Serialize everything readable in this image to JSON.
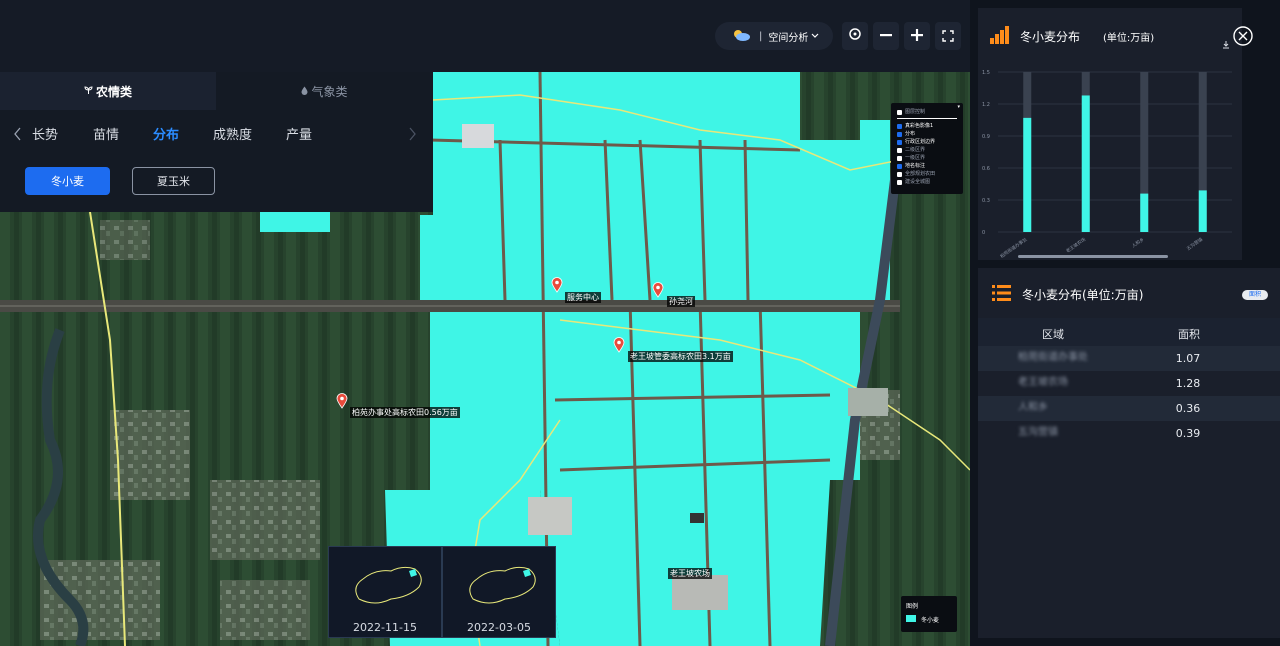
{
  "toolbar": {
    "weather_icon": "cloud-sun-icon",
    "spatial_analysis_label": "空间分析",
    "spatial_analysis_icon": "chevron-down-icon",
    "locate_icon": "locate-icon",
    "zoom_out_icon": "minus-icon",
    "zoom_in_icon": "plus-icon",
    "fullscreen_icon": "fullscreen-icon"
  },
  "left_panel": {
    "tabs": [
      {
        "label": "农情类",
        "icon": "sprout-icon",
        "active": true
      },
      {
        "label": "气象类",
        "icon": "droplet-icon",
        "active": false
      }
    ],
    "subnav": [
      {
        "label": "长势",
        "active": false
      },
      {
        "label": "苗情",
        "active": false
      },
      {
        "label": "分布",
        "active": true
      },
      {
        "label": "成熟度",
        "active": false
      },
      {
        "label": "产量",
        "active": false
      }
    ],
    "prev_icon": "chevron-left-icon",
    "next_icon": "chevron-right-icon",
    "crops": [
      {
        "label": "冬小麦",
        "active": true
      },
      {
        "label": "夏玉米",
        "active": false
      }
    ]
  },
  "map_labels": [
    {
      "text": "服务中心"
    },
    {
      "text": "孙尧河"
    },
    {
      "text": "老王坡管委高标农田3.1万亩"
    },
    {
      "text": "柏苑办事处高标农田0.56万亩"
    },
    {
      "text": "老王坡农场"
    }
  ],
  "layer_control": {
    "items": [
      {
        "label": "图层控制",
        "checked": false
      },
      {
        "label": "真彩色影像1",
        "checked": true
      },
      {
        "label": "分布",
        "checked": true
      },
      {
        "label": "行政区划边界",
        "checked": true
      },
      {
        "label": "二级区界",
        "checked": false
      },
      {
        "label": "一级区界",
        "checked": false
      },
      {
        "label": "地名标注",
        "checked": true
      },
      {
        "label": "全部规划农田",
        "checked": false
      },
      {
        "label": "建设全城图",
        "checked": false
      }
    ]
  },
  "thumbnails": [
    {
      "date": "2022-11-15"
    },
    {
      "date": "2022-03-05"
    }
  ],
  "map_legend": {
    "title": "图例",
    "items": [
      {
        "label": "冬小麦",
        "color": "#3ff5e6"
      }
    ]
  },
  "chart_panel": {
    "title": "冬小麦分布",
    "unit": "(单位:万亩)",
    "download_icon": "download-icon",
    "close_icon": "close-circle-icon",
    "title_icon": "bar-chart-icon"
  },
  "chart_data": {
    "type": "bar",
    "title": "冬小麦分布 (单位:万亩)",
    "categories": [
      "柏苑街道办事处",
      "老王坡农场",
      "人和乡",
      "五沟营镇"
    ],
    "values": [
      1.07,
      1.28,
      0.36,
      0.39
    ],
    "ylim": [
      0,
      1.5
    ],
    "yticks": [
      "0",
      "0.3",
      "0.6",
      "0.9",
      "1.2",
      "1.5"
    ],
    "bar_color": "#3ff5e6",
    "track_color": "#3a4250",
    "grid": true
  },
  "table_panel": {
    "title": "冬小麦分布(单位:万亩)",
    "title_icon": "list-icon",
    "toggle_label": "面积",
    "columns": [
      "区域",
      "面积"
    ],
    "rows": [
      {
        "region": "柏苑街道办事处",
        "area": "1.07"
      },
      {
        "region": "老王坡农场",
        "area": "1.28"
      },
      {
        "region": "人和乡",
        "area": "0.36"
      },
      {
        "region": "五沟营镇",
        "area": "0.39"
      }
    ]
  },
  "colors": {
    "accent": "#1d6cf0",
    "wheat": "#3ff5e6",
    "panel_bg": "#1a1f2b",
    "pin": "#e94b3c",
    "title_icon": "#ff8c1a"
  }
}
